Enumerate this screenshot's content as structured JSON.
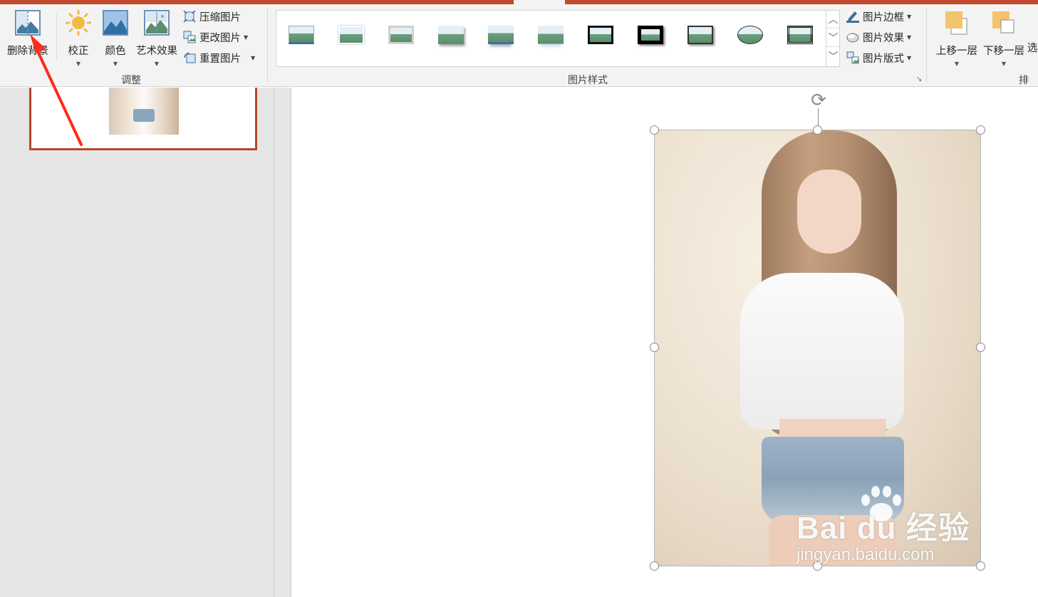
{
  "ribbon": {
    "adjust_group": {
      "label": "调整",
      "remove_background": "删除背景",
      "corrections": "校正",
      "color": "颜色",
      "artistic_effects": "艺术效果",
      "compress_pictures": "压缩图片",
      "change_picture": "更改图片",
      "reset_picture": "重置图片"
    },
    "styles_group": {
      "label": "图片样式",
      "picture_border": "图片边框",
      "picture_effects": "图片效果",
      "picture_layout": "图片版式",
      "style_count": 11
    },
    "arrange_group": {
      "label": "排列",
      "bring_forward": "上移一层",
      "send_backward": "下移一层",
      "selection_pane_partial": "选"
    }
  },
  "watermark": {
    "brand": "Bai du 经验",
    "url": "jingyan.baidu.com"
  },
  "colors": {
    "accent": "#c14a2c",
    "ribbon_bg": "#f3f3f3",
    "panel_bg": "#e6e6e6",
    "slide_border": "#b7472a",
    "annotation_arrow": "#ff2a1a"
  }
}
